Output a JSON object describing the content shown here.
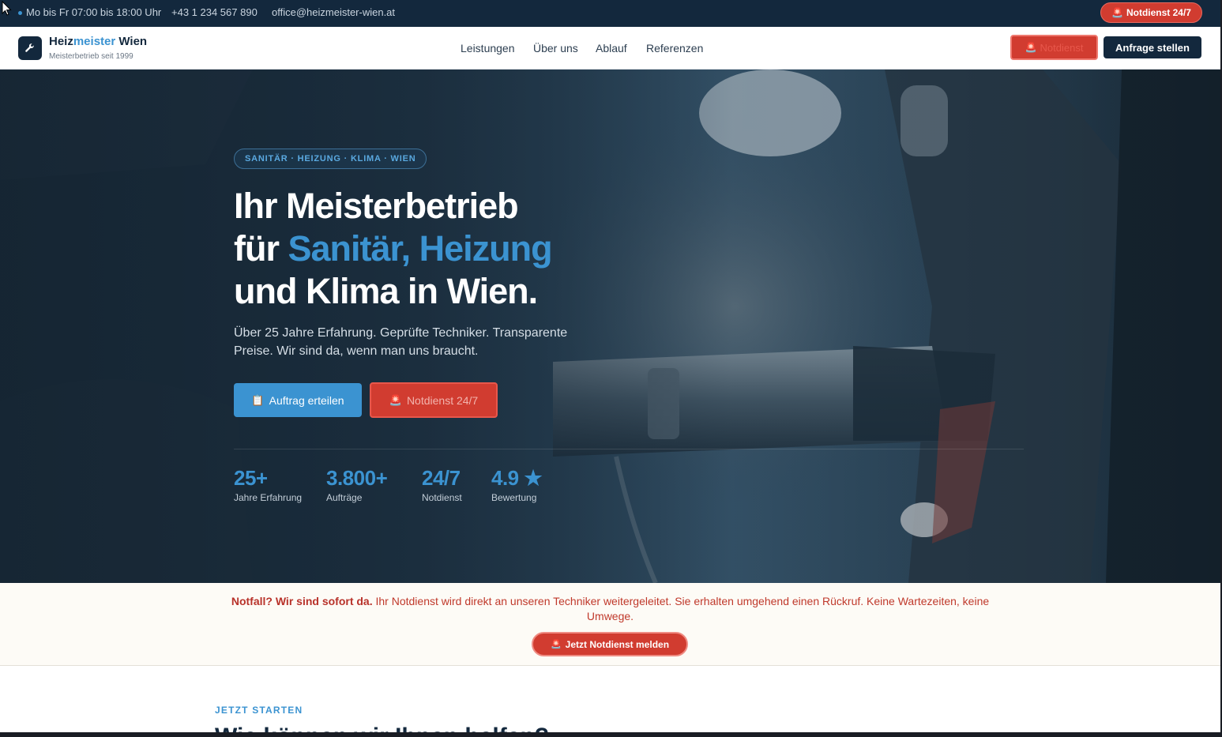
{
  "topbar": {
    "hours": "Mo bis Fr 07:00 bis 18:00 Uhr",
    "phone": "+43 1 234 567 890",
    "email": "office@heizmeister-wien.at",
    "emergency_label": "Notdienst 24/7"
  },
  "brand": {
    "name_part1": "Heiz",
    "name_part2": "meister",
    "name_part3": " Wien",
    "subtitle": "Meisterbetrieb seit 1999",
    "icon": "wrench-icon"
  },
  "nav": {
    "items": [
      "Leistungen",
      "Über uns",
      "Ablauf",
      "Referenzen"
    ],
    "emergency_label": "Notdienst",
    "request_label": "Anfrage stellen"
  },
  "hero": {
    "tagline": "SANITÄR · HEIZUNG · KLIMA · WIEN",
    "title_line1": "Ihr Meisterbetrieb",
    "title_line2_prefix": "für ",
    "title_line2_highlight": "Sanitär, Heizung",
    "title_line3": "und Klima in Wien.",
    "text": "Über 25 Jahre Erfahrung. Geprüfte Techniker. Transparente Preise. Wir sind da, wenn man uns braucht.",
    "primary_button": "Auftrag erteilen",
    "secondary_button": "Notdienst 24/7",
    "stats": [
      {
        "value": "25+",
        "label": "Jahre Erfahrung"
      },
      {
        "value": "3.800+",
        "label": "Aufträge"
      },
      {
        "value": "24/7",
        "label": "Notdienst"
      },
      {
        "value": "4.9 ★",
        "label": "Bewertung"
      }
    ]
  },
  "emergency_strip": {
    "lead": "Notfall? Wir sind sofort da.",
    "text": " Ihr Notdienst wird direkt an unseren Techniker weitergeleitet. Sie erhalten umgehend einen Rückruf. Keine Wartezeiten, keine Umwege.",
    "button": "Jetzt Notdienst melden"
  },
  "next_section": {
    "kicker": "JETZT STARTEN",
    "title_peek": "Wie können wir Ihnen helfen?"
  },
  "colors": {
    "navy": "#13283d",
    "accent_blue": "#3b93d1",
    "emergency_red": "#d13c30"
  }
}
